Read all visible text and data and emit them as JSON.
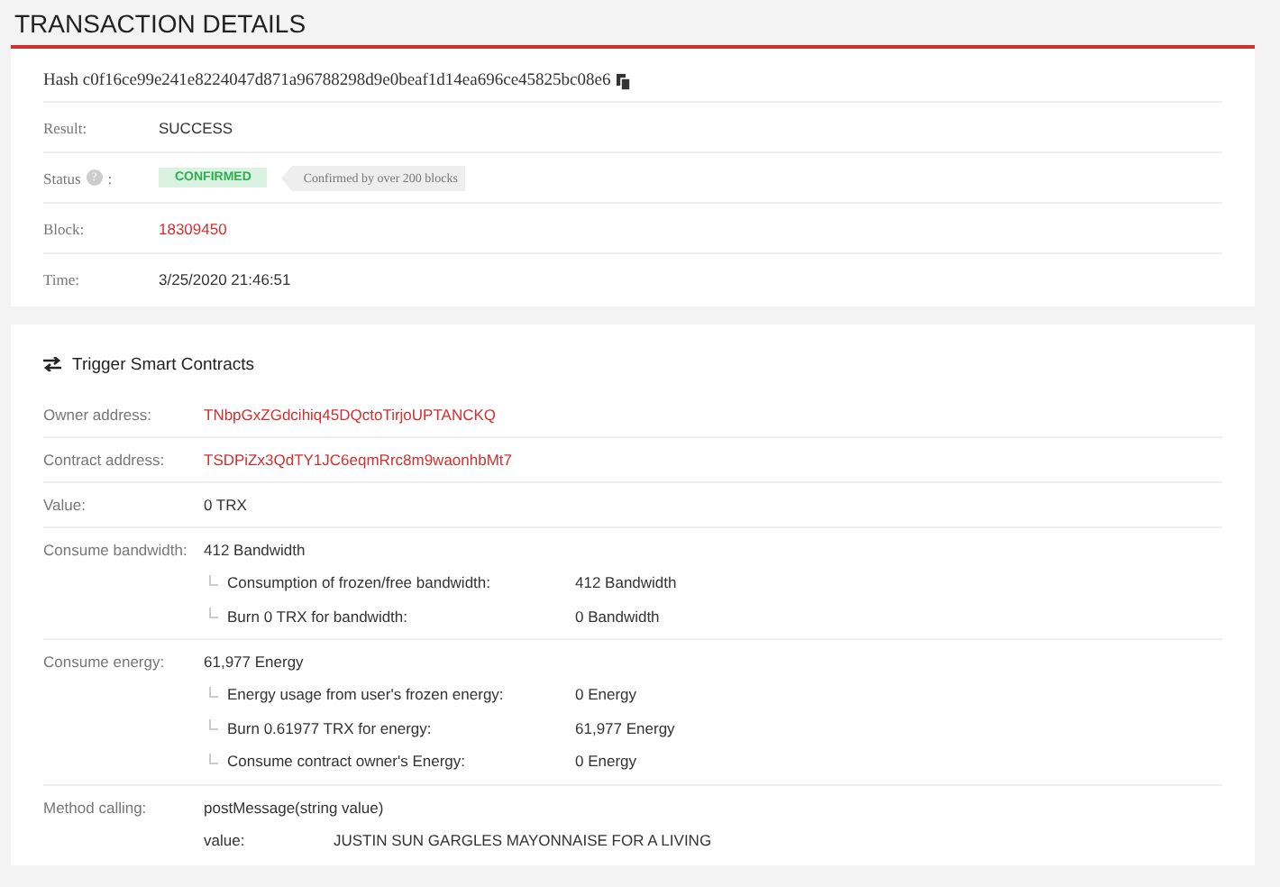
{
  "title": "TRANSACTION DETAILS",
  "hash": {
    "label": "Hash",
    "value": "c0f16ce99e241e8224047d871a96788298d9e0beaf1d14ea696ce45825bc08e6"
  },
  "summary": [
    {
      "kind": "text",
      "label": "Result:",
      "value": "SUCCESS"
    },
    {
      "kind": "status",
      "label": "Status",
      "help": "?",
      "suffix": ":",
      "value": "CONFIRMED",
      "note": "Confirmed by over 200 blocks"
    },
    {
      "kind": "link",
      "label": "Block:",
      "value": "18309450"
    },
    {
      "kind": "text",
      "label": "Time:",
      "value": "3/25/2020 21:46:51"
    }
  ],
  "contract": {
    "title": "Trigger Smart Contracts",
    "rows": [
      {
        "kind": "link",
        "label": "Owner address:",
        "value": "TNbpGxZGdcihiq45DQctoTirjoUPTANCKQ"
      },
      {
        "kind": "link",
        "label": "Contract address:",
        "value": "TSDPiZx3QdTY1JC6eqmRrc8m9waonhbMt7"
      },
      {
        "kind": "text",
        "label": "Value:",
        "value": "0 TRX"
      },
      {
        "kind": "text",
        "label": "Consume bandwidth:",
        "value": "412 Bandwidth",
        "details": [
          {
            "label": "Consumption of frozen/free bandwidth:",
            "value": "412 Bandwidth"
          },
          {
            "label": "Burn 0 TRX for bandwidth:",
            "value": "0 Bandwidth"
          }
        ]
      },
      {
        "kind": "text",
        "label": "Consume energy:",
        "value": "61,977 Energy",
        "details": [
          {
            "label": "Energy usage from user's frozen energy:",
            "value": "0 Energy"
          },
          {
            "label": "Burn 0.61977 TRX for energy:",
            "value": "61,977 Energy"
          },
          {
            "label": "Consume contract owner's Energy:",
            "value": "0 Energy"
          }
        ]
      },
      {
        "kind": "method",
        "label": "Method calling:",
        "value": "postMessage(string value)",
        "params": [
          {
            "name": "value:",
            "value": "JUSTIN SUN GARGLES MAYONNAISE FOR A LIVING"
          }
        ]
      }
    ]
  }
}
